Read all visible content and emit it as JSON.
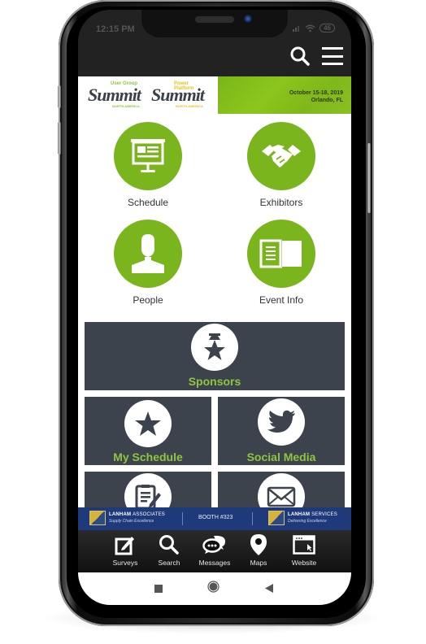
{
  "status_bar": {
    "time": "12:15 PM",
    "battery": "46"
  },
  "header": {
    "search_icon": "search-icon",
    "menu_icon": "hamburger-menu-icon"
  },
  "banner": {
    "logo1": {
      "top": "User Group",
      "main": "Summit",
      "sub": "NORTH AMERICA"
    },
    "logo2": {
      "top": "Power Platform",
      "main": "Summit",
      "sub": "NORTH AMERICA"
    },
    "date": "October 15-18, 2019",
    "location": "Orlando, FL"
  },
  "colors": {
    "green": "#7ab51d",
    "label_green": "#8dc63f",
    "tile_dark": "#3d434d",
    "ad_blue": "#1f3a7a",
    "header_dark": "#222222"
  },
  "main_menu": [
    {
      "label": "Schedule",
      "icon": "presentation-board-icon"
    },
    {
      "label": "Exhibitors",
      "icon": "handshake-icon"
    },
    {
      "label": "People",
      "icon": "person-icon"
    },
    {
      "label": "Event Info",
      "icon": "open-book-icon"
    }
  ],
  "dark_tiles": [
    {
      "label": "Sponsors",
      "icon": "award-star-icon"
    },
    {
      "label": "My Schedule",
      "icon": "star-icon"
    },
    {
      "label": "Social Media",
      "icon": "twitter-bird-icon"
    },
    {
      "label": "",
      "icon": "survey-edit-icon"
    },
    {
      "label": "",
      "icon": "envelope-icon"
    }
  ],
  "ad": {
    "left_name_bold": "LANHAM",
    "left_name": "ASSOCIATES",
    "left_tag": "Supply Chain Excellence",
    "booth": "BOOTH #323",
    "right_name_bold": "LANHAM",
    "right_name": "SERVICES",
    "right_tag": "Delivering Excellence"
  },
  "tabbar": [
    {
      "label": "Surveys",
      "icon": "edit-square-icon"
    },
    {
      "label": "Search",
      "icon": "search-icon"
    },
    {
      "label": "Messages",
      "icon": "chat-bubbles-icon"
    },
    {
      "label": "Maps",
      "icon": "map-pin-icon"
    },
    {
      "label": "Website",
      "icon": "browser-window-icon"
    }
  ],
  "navbar": {
    "recents": "recents-square-icon",
    "home": "home-circle-icon",
    "back": "back-triangle-icon"
  }
}
